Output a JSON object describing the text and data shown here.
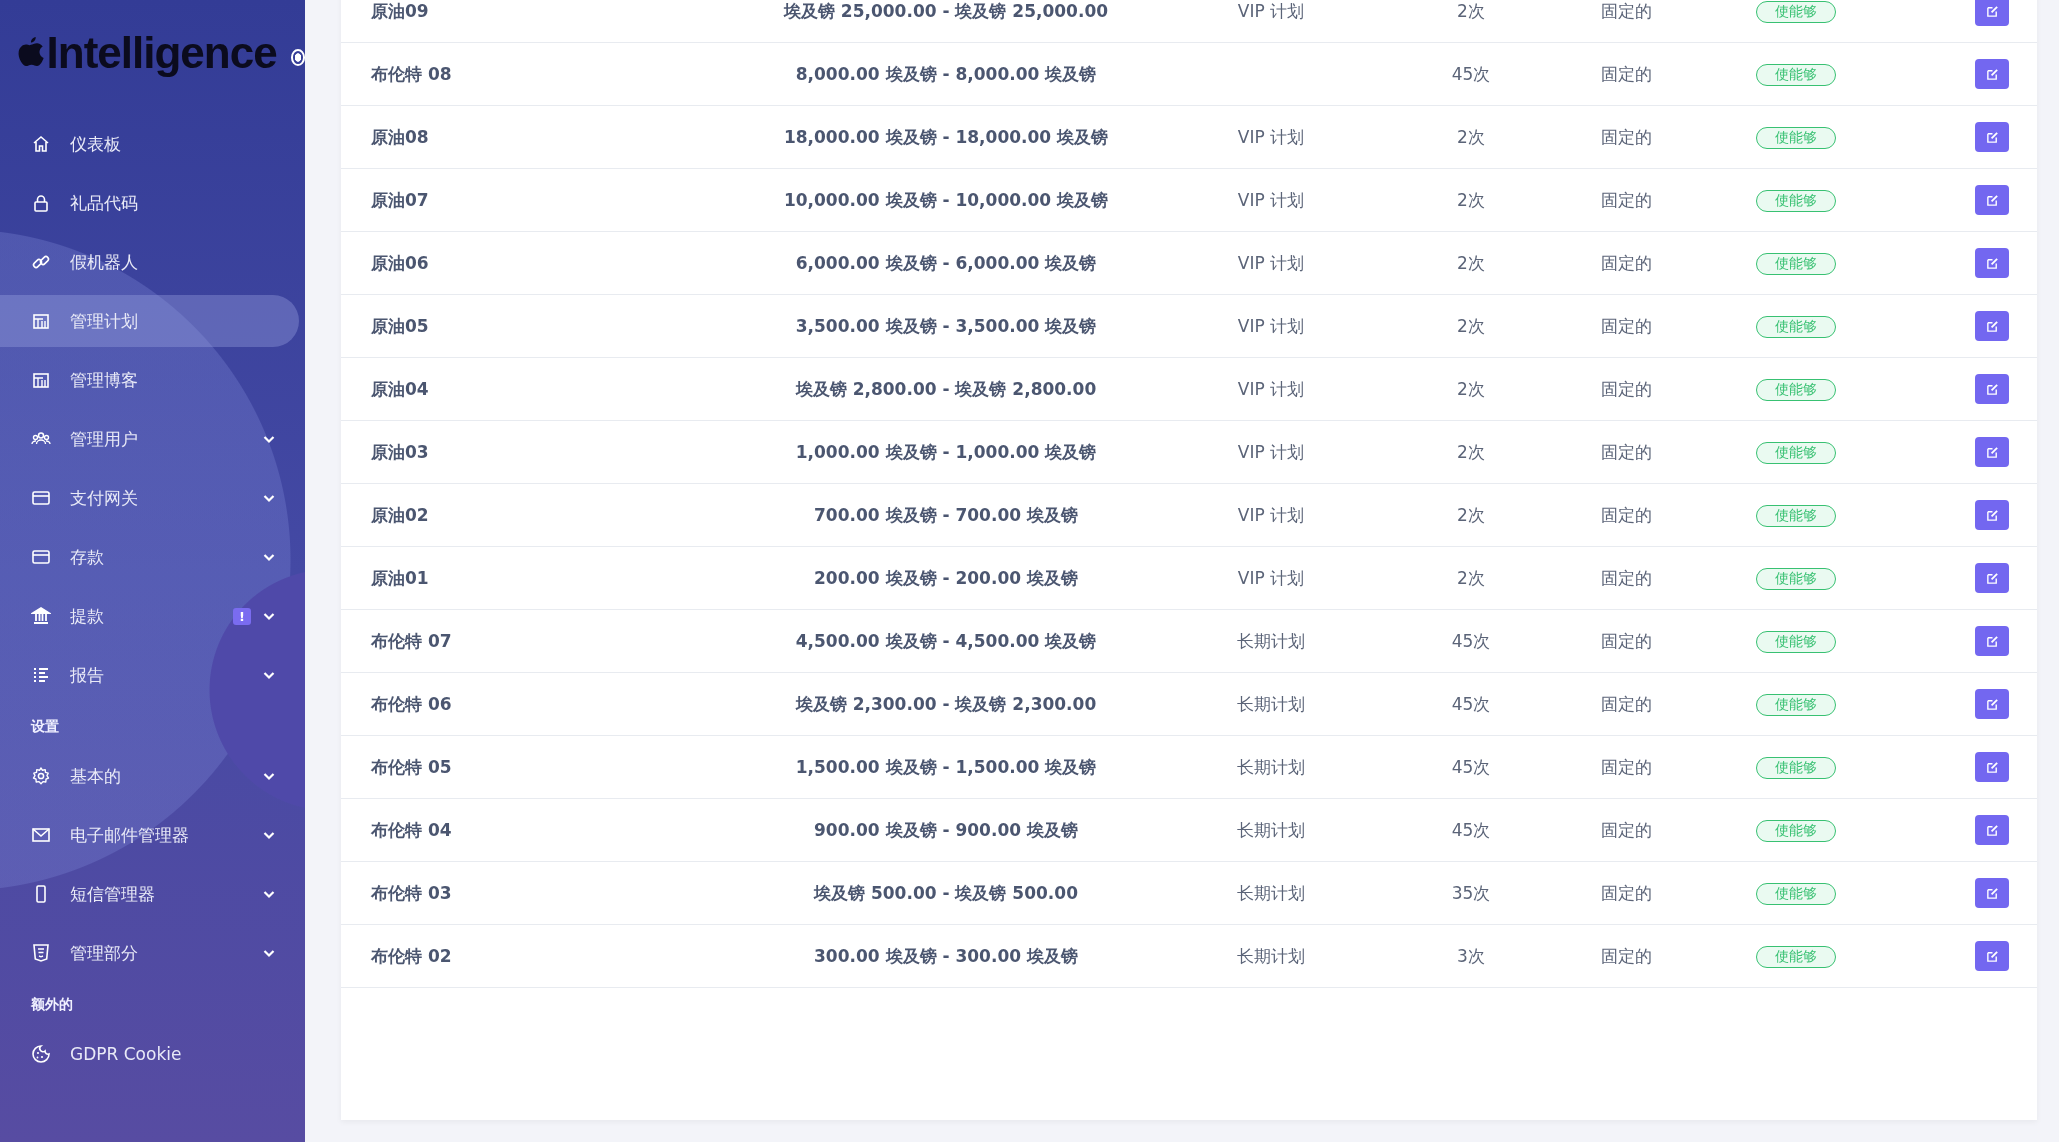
{
  "sidebar": {
    "logo": "Intelligence",
    "sections": [
      {
        "items": [
          {
            "label": "仪表板",
            "kind": "home",
            "expandable": false,
            "selected": false
          },
          {
            "label": "礼品代码",
            "kind": "lock",
            "expandable": false,
            "selected": false
          },
          {
            "label": "假机器人",
            "kind": "link",
            "expandable": false,
            "selected": false
          },
          {
            "label": "管理计划",
            "kind": "building",
            "expandable": false,
            "selected": true
          },
          {
            "label": "管理博客",
            "kind": "building",
            "expandable": false,
            "selected": false
          },
          {
            "label": "管理用户",
            "kind": "users",
            "expandable": true,
            "selected": false
          },
          {
            "label": "支付网关",
            "kind": "card",
            "expandable": true,
            "selected": false
          },
          {
            "label": "存款",
            "kind": "card",
            "expandable": true,
            "selected": false
          },
          {
            "label": "提款",
            "kind": "bank",
            "expandable": true,
            "selected": false,
            "badge": "!"
          },
          {
            "label": "报告",
            "kind": "list",
            "expandable": true,
            "selected": false
          }
        ]
      },
      {
        "title": "设置",
        "items": [
          {
            "label": "基本的",
            "kind": "gear",
            "expandable": true,
            "selected": false
          },
          {
            "label": "电子邮件管理器",
            "kind": "mail",
            "expandable": true,
            "selected": false
          },
          {
            "label": "短信管理器",
            "kind": "phone",
            "expandable": true,
            "selected": false
          },
          {
            "label": "管理部分",
            "kind": "html",
            "expandable": true,
            "selected": false
          }
        ]
      },
      {
        "title": "额外的",
        "items": [
          {
            "label": "GDPR Cookie",
            "kind": "cookie",
            "expandable": false,
            "selected": false
          }
        ]
      }
    ]
  },
  "table": {
    "rows": [
      {
        "name": "原油09",
        "amount": "埃及镑 25,000.00 - 埃及镑 25,000.00",
        "plan": "VIP 计划",
        "count": "2次",
        "type": "固定的",
        "status": "使能够"
      },
      {
        "name": "布伦特 08",
        "amount": "8,000.00 埃及镑 - 8,000.00 埃及镑",
        "count": "45次",
        "type": "固定的",
        "status": "使能够"
      },
      {
        "name": "原油08",
        "amount": "18,000.00 埃及镑 - 18,000.00 埃及镑",
        "plan": "VIP 计划",
        "count": "2次",
        "type": "固定的",
        "status": "使能够"
      },
      {
        "name": "原油07",
        "amount": "10,000.00 埃及镑 - 10,000.00 埃及镑",
        "plan": "VIP 计划",
        "count": "2次",
        "type": "固定的",
        "status": "使能够"
      },
      {
        "name": "原油06",
        "amount": "6,000.00 埃及镑 - 6,000.00 埃及镑",
        "plan": "VIP 计划",
        "count": "2次",
        "type": "固定的",
        "status": "使能够"
      },
      {
        "name": "原油05",
        "amount": "3,500.00 埃及镑 - 3,500.00 埃及镑",
        "plan": "VIP 计划",
        "count": "2次",
        "type": "固定的",
        "status": "使能够"
      },
      {
        "name": "原油04",
        "amount": "埃及镑 2,800.00 - 埃及镑 2,800.00",
        "plan": "VIP 计划",
        "count": "2次",
        "type": "固定的",
        "status": "使能够"
      },
      {
        "name": "原油03",
        "amount": "1,000.00 埃及镑 - 1,000.00 埃及镑",
        "plan": "VIP 计划",
        "count": "2次",
        "type": "固定的",
        "status": "使能够"
      },
      {
        "name": "原油02",
        "amount": "700.00 埃及镑 - 700.00 埃及镑",
        "plan": "VIP 计划",
        "count": "2次",
        "type": "固定的",
        "status": "使能够"
      },
      {
        "name": "原油01",
        "amount": "200.00 埃及镑 - 200.00 埃及镑",
        "plan": "VIP 计划",
        "count": "2次",
        "type": "固定的",
        "status": "使能够"
      },
      {
        "name": "布伦特 07",
        "amount": "4,500.00 埃及镑 - 4,500.00 埃及镑",
        "plan": "长期计划",
        "count": "45次",
        "type": "固定的",
        "status": "使能够"
      },
      {
        "name": "布伦特 06",
        "amount": "埃及镑 2,300.00 - 埃及镑 2,300.00",
        "plan": "长期计划",
        "count": "45次",
        "type": "固定的",
        "status": "使能够"
      },
      {
        "name": "布伦特 05",
        "amount": "1,500.00 埃及镑 - 1,500.00 埃及镑",
        "plan": "长期计划",
        "count": "45次",
        "type": "固定的",
        "status": "使能够"
      },
      {
        "name": "布伦特 04",
        "amount": "900.00 埃及镑 - 900.00 埃及镑",
        "plan": "长期计划",
        "count": "45次",
        "type": "固定的",
        "status": "使能够"
      },
      {
        "name": "布伦特 03",
        "amount": "埃及镑 500.00 - 埃及镑 500.00",
        "plan": "长期计划",
        "count": "35次",
        "type": "固定的",
        "status": "使能够"
      },
      {
        "name": "布伦特 02",
        "amount": "300.00 埃及镑 - 300.00 埃及镑",
        "plan": "长期计划",
        "count": "3次",
        "type": "固定的",
        "status": "使能够"
      }
    ]
  }
}
